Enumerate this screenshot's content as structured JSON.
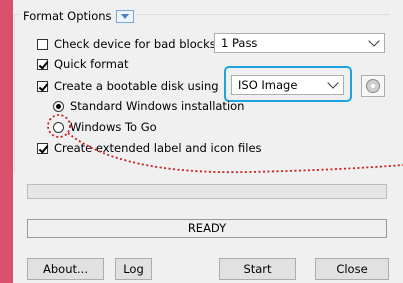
{
  "format_options": {
    "title": "Format Options",
    "check_bad_blocks_label": "Check device for bad blocks",
    "check_bad_blocks_checked": false,
    "passes_value": "1 Pass",
    "quick_format_label": "Quick format",
    "quick_format_checked": true,
    "bootable_label": "Create a bootable disk using",
    "bootable_checked": true,
    "image_type_value": "ISO Image",
    "radio_standard_label": "Standard Windows installation",
    "radio_wtg_label": "Windows To Go",
    "extended_label": "Create extended label and icon files",
    "extended_checked": true
  },
  "status": {
    "text": "READY",
    "progress": 0
  },
  "buttons": {
    "about": "About...",
    "log": "Log",
    "start": "Start",
    "close": "Close"
  },
  "colors": {
    "accent_bar": "#d8506b",
    "highlight": "#1fa3dd",
    "annotation": "#cc1e1e"
  }
}
